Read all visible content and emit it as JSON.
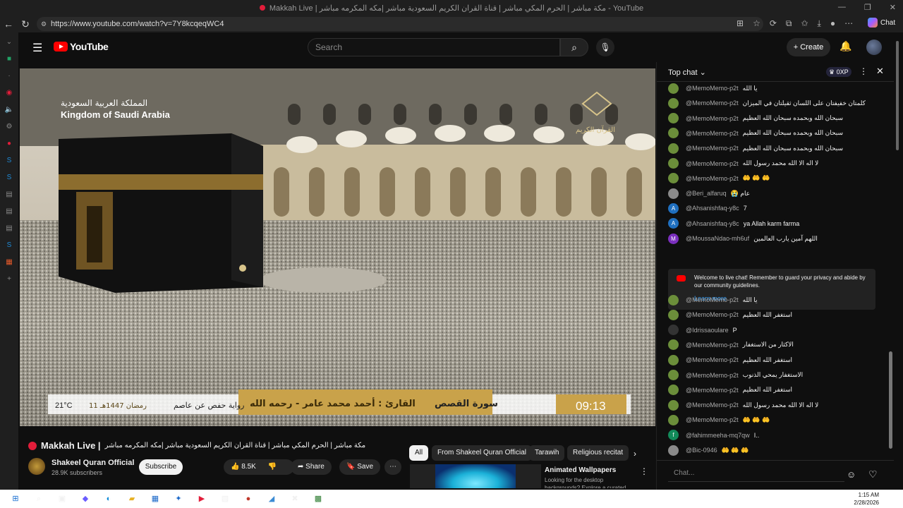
{
  "browser": {
    "window_title": "Makkah Live | مكة مباشر | الحرم المكي مباشر | قناة القران الكريم السعودية مباشر |مكه المكرمه مباشر - YouTube",
    "url": "https://www.youtube.com/watch?v=7Y8kcqeqWC4",
    "chat_label": "Chat"
  },
  "youtube": {
    "logo_text": "YouTube",
    "search_placeholder": "Search",
    "create_label": "Create"
  },
  "video": {
    "overlay_ar": "المملكة العربية السعودية",
    "overlay_en": "Kingdom of Saudi Arabia",
    "channel_overlay": "القرآن الكريم",
    "temperature": "21°C",
    "date_hijri": "11 رمضان 1447هـ",
    "narration": "رواية حفص عن عاصم",
    "reciter": "القارئ : أحمد محمد عامر - رحمه الله",
    "surah": "سورة القصص",
    "time": "09:13"
  },
  "watch": {
    "title_en": "Makkah Live |",
    "title_ar": "مكة مباشر | الحرم المكي مباشر | قناة القران الكريم السعودية مباشر |مكه المكرمه مباشر",
    "channel_name": "Shakeel Quran Official",
    "subscribers": "28.9K subscribers",
    "subscribe_label": "Subscribe",
    "likes": "8.5K",
    "share_label": "Share",
    "save_label": "Save"
  },
  "chips": [
    "All",
    "From Shakeel Quran Official",
    "Tarawih",
    "Religious recitat"
  ],
  "recommendation": {
    "title": "Animated Wallpapers",
    "description": "Looking for the desktop backgrounds? Explore a curated"
  },
  "chat": {
    "header": "Top chat",
    "xp": "0XP",
    "welcome_text": "Welcome to live chat! Remember to guard your privacy and abide by our community guidelines.",
    "learn_more": "Learn more",
    "input_placeholder": "Chat...",
    "messages_top": [
      {
        "name": "@MemoMemo-p2t",
        "text": "يا الله",
        "color": "#6b8e3a",
        "initial": ""
      },
      {
        "name": "@MemoMemo-p2t",
        "text": "كلمتان خفيفتان على اللسان ثقيلتان في الميزان",
        "color": "#6b8e3a",
        "initial": ""
      },
      {
        "name": "@MemoMemo-p2t",
        "text": "سبحان الله وبحمده سبحان الله العظيم",
        "color": "#6b8e3a",
        "initial": ""
      },
      {
        "name": "@MemoMemo-p2t",
        "text": "سبحان الله وبحمده سبحان الله العظيم",
        "color": "#6b8e3a",
        "initial": ""
      },
      {
        "name": "@MemoMemo-p2t",
        "text": "سبحان الله وبحمده سبحان الله العظيم",
        "color": "#6b8e3a",
        "initial": ""
      },
      {
        "name": "@MemoMemo-p2t",
        "text": "لا اله الا الله محمد رسول الله",
        "color": "#6b8e3a",
        "initial": ""
      },
      {
        "name": "@MemoMemo-p2t",
        "text": "🤲 🤲 🤲",
        "color": "#6b8e3a",
        "initial": ""
      },
      {
        "name": "@Beri_alfaruq",
        "text": "😭 عام",
        "color": "#8a8a8a",
        "initial": ""
      },
      {
        "name": "@Ahsanishfaq-y8c",
        "text": "7",
        "color": "#1f6fbf",
        "initial": "A"
      },
      {
        "name": "@Ahsanishfaq-y8c",
        "text": "ya Allah karm farma",
        "color": "#1f6fbf",
        "initial": "A"
      },
      {
        "name": "@MoussaNdao-mh6uf",
        "text": "اللهم آمين يارب العالمين",
        "color": "#7b2fbe",
        "initial": "M"
      }
    ],
    "messages_bottom": [
      {
        "name": "@MemoMemo-p2t",
        "text": "يا الله",
        "color": "#6b8e3a",
        "initial": ""
      },
      {
        "name": "@MemoMemo-p2t",
        "text": "استغفر الله العظيم",
        "color": "#6b8e3a",
        "initial": ""
      },
      {
        "name": "@Idrissaoulare",
        "text": "P",
        "color": "#333333",
        "initial": ""
      },
      {
        "name": "@MemoMemo-p2t",
        "text": "الاكثار من الاستغفار",
        "color": "#6b8e3a",
        "initial": ""
      },
      {
        "name": "@MemoMemo-p2t",
        "text": "استغفر الله العظيم",
        "color": "#6b8e3a",
        "initial": ""
      },
      {
        "name": "@MemoMemo-p2t",
        "text": "الاستغفار يمحي الذنوب",
        "color": "#6b8e3a",
        "initial": ""
      },
      {
        "name": "@MemoMemo-p2t",
        "text": "استغفر الله العظيم",
        "color": "#6b8e3a",
        "initial": ""
      },
      {
        "name": "@MemoMemo-p2t",
        "text": "لا اله الا الله محمد رسول الله",
        "color": "#6b8e3a",
        "initial": ""
      },
      {
        "name": "@MemoMemo-p2t",
        "text": "🤲 🤲 🤲",
        "color": "#6b8e3a",
        "initial": ""
      },
      {
        "name": "@fahimmeeha-mq7qw",
        "text": "I..",
        "color": "#128a5a",
        "initial": "f"
      },
      {
        "name": "@Bic-0946",
        "text": "🤲 🤲 🤲",
        "color": "#8a8a8a",
        "initial": ""
      }
    ]
  },
  "taskbar": {
    "time": "1:15 AM",
    "date": "2/28/2026"
  }
}
